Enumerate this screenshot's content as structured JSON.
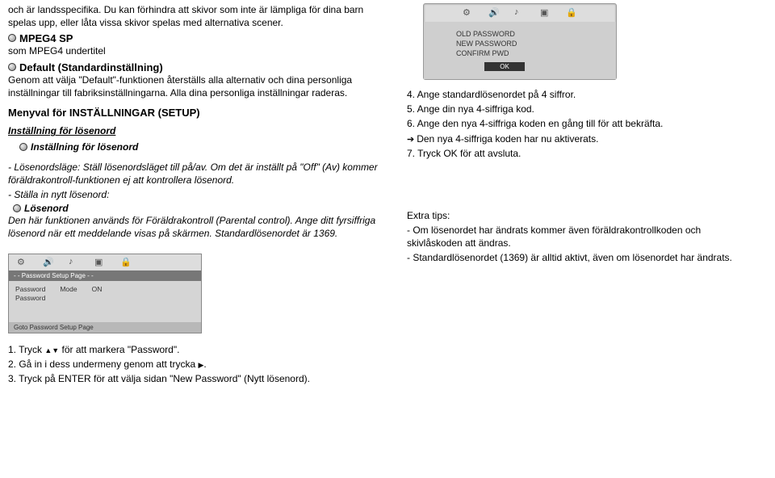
{
  "left": {
    "p1": "och är landsspecifika. Du kan förhindra att skivor som inte är lämpliga för dina barn spelas upp, eller låta vissa skivor spelas med alternativa scener.",
    "mpeg4sp": "MPEG4 SP",
    "mpeg4sub": "som MPEG4 undertitel",
    "defaultHeading": "Default (Standardinställning)",
    "defaultBody": "Genom att välja \"Default\"-funktionen återställs alla alternativ och dina personliga inställningar till fabriksinställningarna. Alla dina personliga inställningar raderas.",
    "menyval": "Menyval för INSTÄLLNINGAR (SETUP)",
    "instLosen1": "Inställning för lösenord",
    "instLosen2": "Inställning för lösenord",
    "losenlagePrefix": "- Lösenordsläge:",
    "losenlageBody": " Ställ lösenordsläget till på/av. Om det är inställt på \"Off\" (Av) kommer föräldrakontroll-funktionen ej att kontrollera lösenord.",
    "stallaIn": "- Ställa in nytt lösenord:",
    "losenord": "Lösenord",
    "losenordBody": "Den här funktionen används för Föräldrakontroll (Parental control). Ange ditt fyrsiffriga lösenord när ett meddelande visas på skärmen. Standardlösenordet är 1369."
  },
  "pwDialog": {
    "old": "OLD PASSWORD",
    "new": "NEW PASSWORD",
    "confirm": "CONFIRM PWD",
    "ok": "OK"
  },
  "right": {
    "s4": "4. Ange standardlösenordet på 4 siffror.",
    "s5": "5. Ange din nya 4-siffriga kod.",
    "s6": "6. Ange den nya 4-siffriga koden en gång till för att bekräfta.",
    "s6b": "Den nya 4-siffriga koden har nu aktiverats.",
    "s7": "7. Tryck OK för att avsluta.",
    "extraTitle": "Extra tips:",
    "extra1": "- Om lösenordet har ändrats kommer även föräldrakontrollkoden och skivlåskoden att ändras.",
    "extra2": "- Standardlösenordet (1369) är alltid aktivt, även om lösenordet har ändrats."
  },
  "setupBox": {
    "title": "- - Password Setup Page - -",
    "row1a": "Password",
    "row1b": "Mode",
    "row1c": "ON",
    "row2a": "Password",
    "footer": "Goto Password Setup Page"
  },
  "bottomSteps": {
    "s1a": "1. Tryck ",
    "s1b": " för att markera \"Password\".",
    "s2a": "2. Gå in i dess undermeny genom att trycka ",
    "s2b": ".",
    "s3": "3. Tryck på ENTER för att välja sidan \"New Password\" (Nytt lösenord)."
  }
}
